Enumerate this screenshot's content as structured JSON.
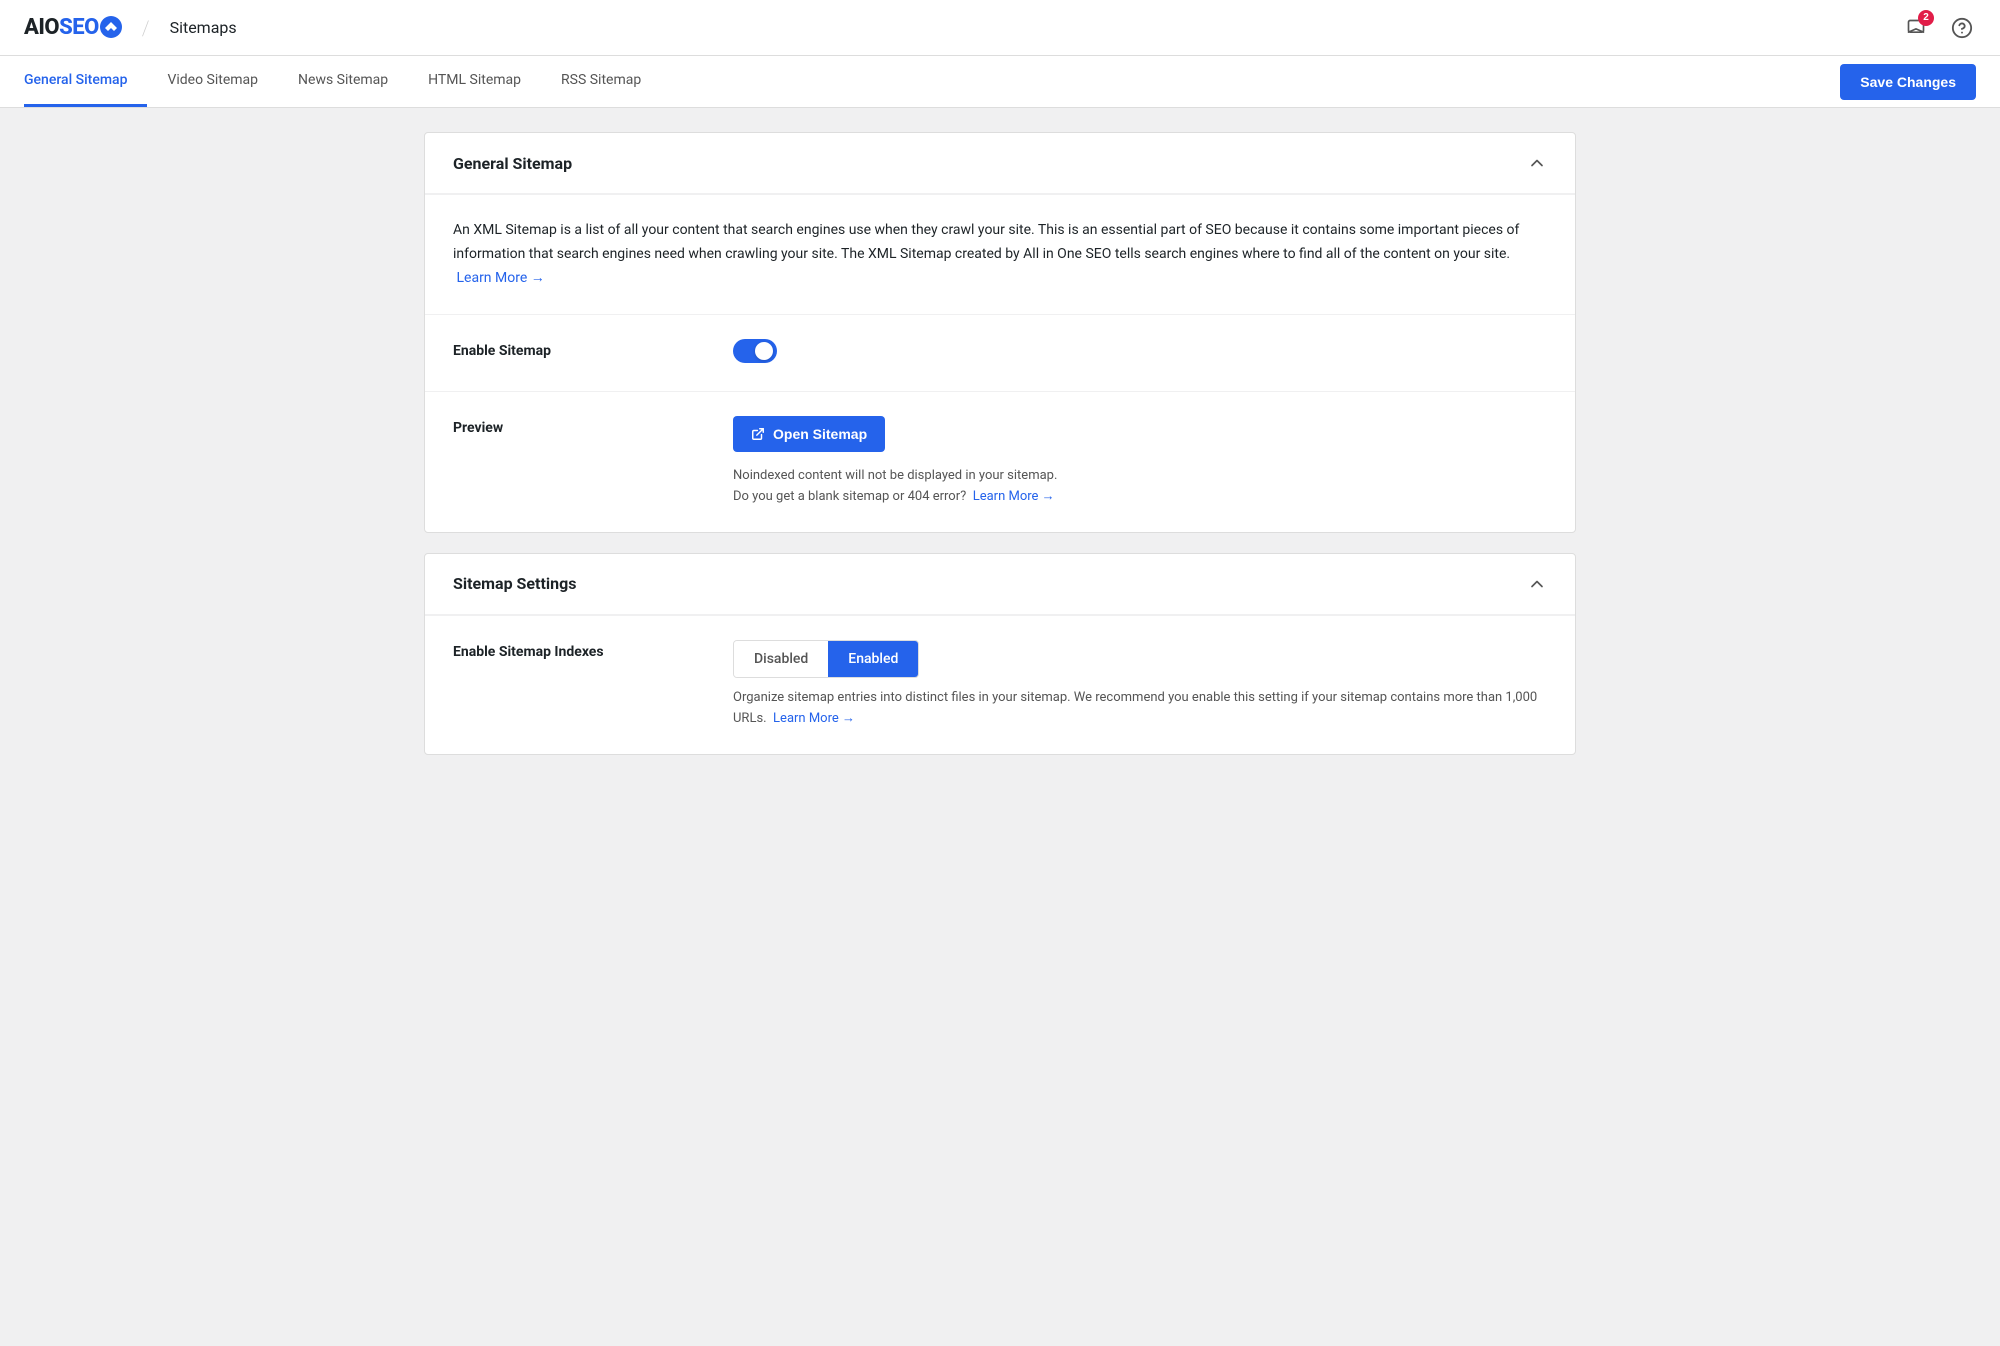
{
  "header": {
    "logo_aio": "AIO",
    "logo_seo": "SEO",
    "divider": "/",
    "page_title": "Sitemaps",
    "notification_count": "2",
    "save_changes_label": "Save Changes"
  },
  "tabs": [
    {
      "id": "general",
      "label": "General Sitemap",
      "active": true
    },
    {
      "id": "video",
      "label": "Video Sitemap",
      "active": false
    },
    {
      "id": "news",
      "label": "News Sitemap",
      "active": false
    },
    {
      "id": "html",
      "label": "HTML Sitemap",
      "active": false
    },
    {
      "id": "rss",
      "label": "RSS Sitemap",
      "active": false
    }
  ],
  "general_sitemap_card": {
    "title": "General Sitemap",
    "description": "An XML Sitemap is a list of all your content that search engines use when they crawl your site. This is an essential part of SEO because it contains some important pieces of information that search engines need when crawling your site. The XML Sitemap created by All in One SEO tells search engines where to find all of the content on your site.",
    "learn_more_label": "Learn More →",
    "enable_sitemap_label": "Enable Sitemap",
    "preview_label": "Preview",
    "open_sitemap_label": "Open Sitemap",
    "preview_note_1": "Noindexed content will not be displayed in your sitemap.",
    "preview_note_2": "Do you get a blank sitemap or 404 error?",
    "preview_note_learn_more": "Learn More →"
  },
  "sitemap_settings_card": {
    "title": "Sitemap Settings",
    "enable_indexes_label": "Enable Sitemap Indexes",
    "disabled_label": "Disabled",
    "enabled_label": "Enabled",
    "indexes_description": "Organize sitemap entries into distinct files in your sitemap. We recommend you enable this setting if your sitemap contains more than 1,000 URLs.",
    "indexes_learn_more": "Learn More →"
  },
  "colors": {
    "primary": "#2563eb",
    "badge": "#e11d48"
  }
}
